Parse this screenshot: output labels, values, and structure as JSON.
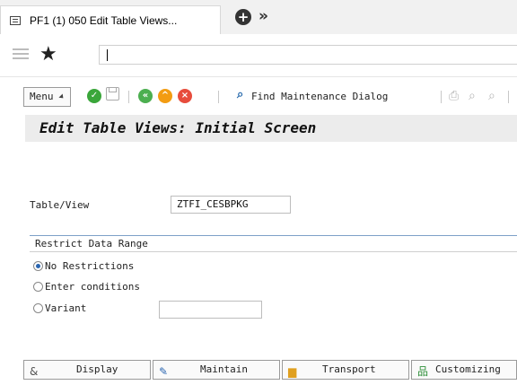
{
  "browser_tab": {
    "title": "PF1 (1) 050 Edit Table Views..."
  },
  "command_field": {
    "value": ""
  },
  "toolbar": {
    "menu_label": "Menu",
    "find_label": "Find Maintenance Dialog"
  },
  "screen": {
    "title": "Edit Table Views: Initial Screen"
  },
  "form": {
    "table_view_label": "Table/View",
    "table_view_value": "ZTFI_CESBPKG"
  },
  "restrict": {
    "header": "Restrict Data Range",
    "options": [
      {
        "label": "No Restrictions",
        "selected": true
      },
      {
        "label": "Enter conditions",
        "selected": false
      },
      {
        "label": "Variant",
        "selected": false
      }
    ],
    "variant_value": ""
  },
  "buttons": {
    "display": "Display",
    "maintain": "Maintain",
    "transport": "Transport",
    "customizing": "Customizing"
  },
  "colors": {
    "green": "#3aa63a",
    "back": "#4caf50",
    "exit": "#f39c12",
    "cancel": "#e74c3c",
    "accent": "#7ea0c8"
  }
}
